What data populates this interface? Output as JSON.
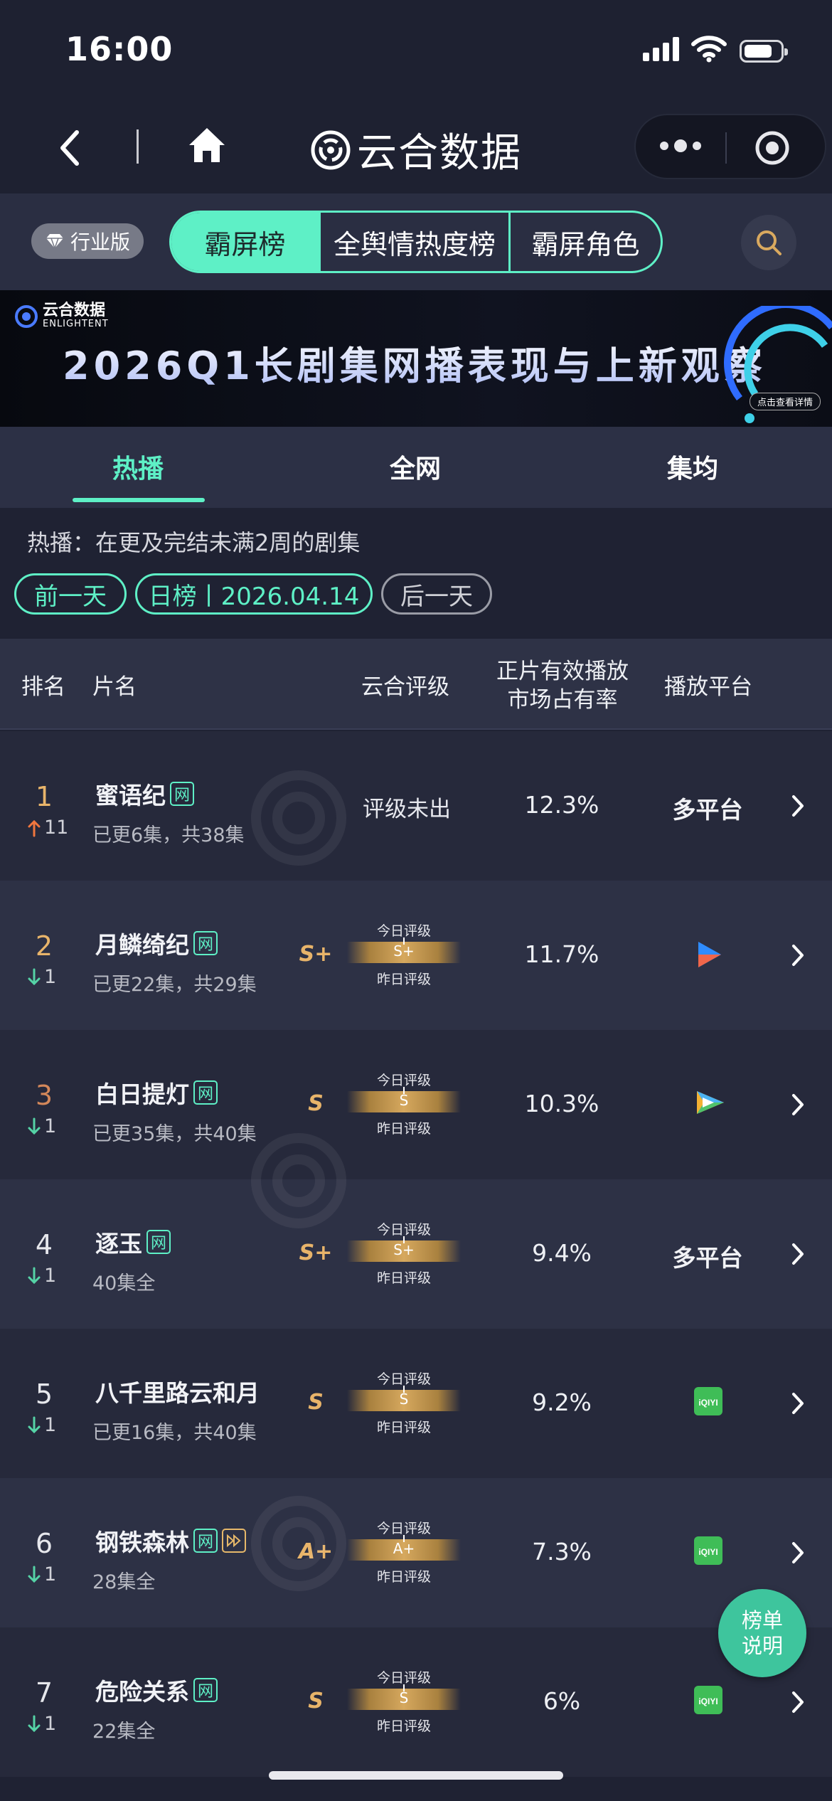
{
  "status_bar": {
    "time": "16:00"
  },
  "nav": {
    "brand_name": "云合数据"
  },
  "toolbar": {
    "edition_badge": "行业版",
    "segments": [
      {
        "label": "霸屏榜",
        "active": true
      },
      {
        "label": "全舆情热度榜",
        "active": false
      },
      {
        "label": "霸屏角色",
        "active": false
      }
    ]
  },
  "banner": {
    "logo_text": "云合数据",
    "logo_sub": "ENLIGHTENT",
    "title": "2026Q1长剧集网播表现与上新观察",
    "cta": "点击查看详情"
  },
  "tabs": [
    {
      "label": "热播",
      "active": true
    },
    {
      "label": "全网",
      "active": false
    },
    {
      "label": "集均",
      "active": false
    }
  ],
  "info": {
    "description": "热播：在更及完结未满2周的剧集",
    "prev_day": "前一天",
    "date_label": "日榜丨2026.04.14",
    "next_day": "后一天"
  },
  "table": {
    "headers": {
      "rank": "排名",
      "title": "片名",
      "rating": "云合评级",
      "share_line1": "正片有效播放",
      "share_line2": "市场占有率",
      "platform": "播放平台"
    },
    "today_label": "今日评级",
    "yesterday_label": "昨日评级",
    "no_rating_text": "评级未出",
    "rows": [
      {
        "rank": "1",
        "change_dir": "up",
        "change": "11",
        "title": "蜜语纪",
        "net_tag": "网",
        "play_tag": false,
        "episodes": "已更6集，共38集",
        "grade": "",
        "rating_text": "评级未出",
        "share": "12.3%",
        "platform_text": "多平台",
        "platform_icon": ""
      },
      {
        "rank": "2",
        "change_dir": "down",
        "change": "1",
        "title": "月鳞绮纪",
        "net_tag": "网",
        "play_tag": false,
        "episodes": "已更22集，共29集",
        "grade": "S+",
        "rating_text": "",
        "share": "11.7%",
        "platform_text": "",
        "platform_icon": "youku-icon"
      },
      {
        "rank": "3",
        "change_dir": "down",
        "change": "1",
        "title": "白日提灯",
        "net_tag": "网",
        "play_tag": false,
        "episodes": "已更35集，共40集",
        "grade": "S",
        "rating_text": "",
        "share": "10.3%",
        "platform_text": "",
        "platform_icon": "tencent-video-icon"
      },
      {
        "rank": "4",
        "change_dir": "down",
        "change": "1",
        "title": "逐玉",
        "net_tag": "网",
        "play_tag": false,
        "episodes": "40集全",
        "grade": "S+",
        "rating_text": "",
        "share": "9.4%",
        "platform_text": "多平台",
        "platform_icon": ""
      },
      {
        "rank": "5",
        "change_dir": "down",
        "change": "1",
        "title": "八千里路云和月",
        "net_tag": "",
        "play_tag": false,
        "episodes": "已更16集，共40集",
        "grade": "S",
        "rating_text": "",
        "share": "9.2%",
        "platform_text": "",
        "platform_icon": "iqiyi-icon"
      },
      {
        "rank": "6",
        "change_dir": "down",
        "change": "1",
        "title": "钢铁森林",
        "net_tag": "网",
        "play_tag": true,
        "episodes": "28集全",
        "grade": "A+",
        "rating_text": "",
        "share": "7.3%",
        "platform_text": "",
        "platform_icon": "iqiyi-icon"
      },
      {
        "rank": "7",
        "change_dir": "down",
        "change": "1",
        "title": "危险关系",
        "net_tag": "网",
        "play_tag": false,
        "episodes": "22集全",
        "grade": "S",
        "rating_text": "",
        "share": "6%",
        "platform_text": "",
        "platform_icon": "iqiyi-icon"
      }
    ]
  },
  "fab": {
    "line1": "榜单",
    "line2": "说明"
  },
  "colors": {
    "accent": "#5ef0c6",
    "rank_top": "#e8b46a",
    "rank_third": "#d3875a",
    "up_arrow": "#f0763e",
    "down_arrow": "#55d3a6",
    "grade": "#e8b46a"
  }
}
